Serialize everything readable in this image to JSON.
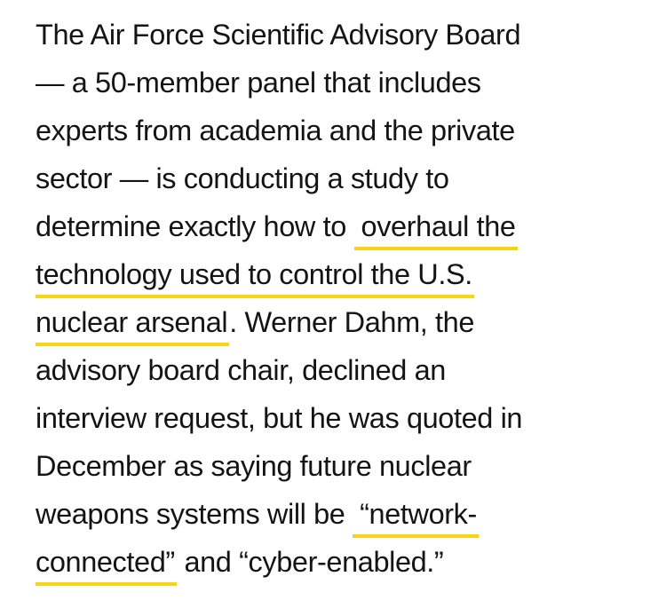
{
  "article": {
    "lines": [
      "The Air Force Scientific Advisory Board",
      "— a 50-member panel that includes",
      "experts from academia and the private",
      "sector — is conducting a study to",
      "determine exactly how to",
      "overhaul the",
      "technology used to control the U.S.",
      "nuclear arsenal",
      ". Werner Dahm, the",
      "advisory board chair, declined an",
      "interview request, but he was quoted in",
      "December as saying future nuclear",
      "weapons systems will be",
      "“network-",
      "connected”",
      "and “cyber-enabled.”"
    ]
  },
  "colors": {
    "text": "#141414",
    "link_underline": "#f5d516",
    "background": "#ffffff"
  }
}
